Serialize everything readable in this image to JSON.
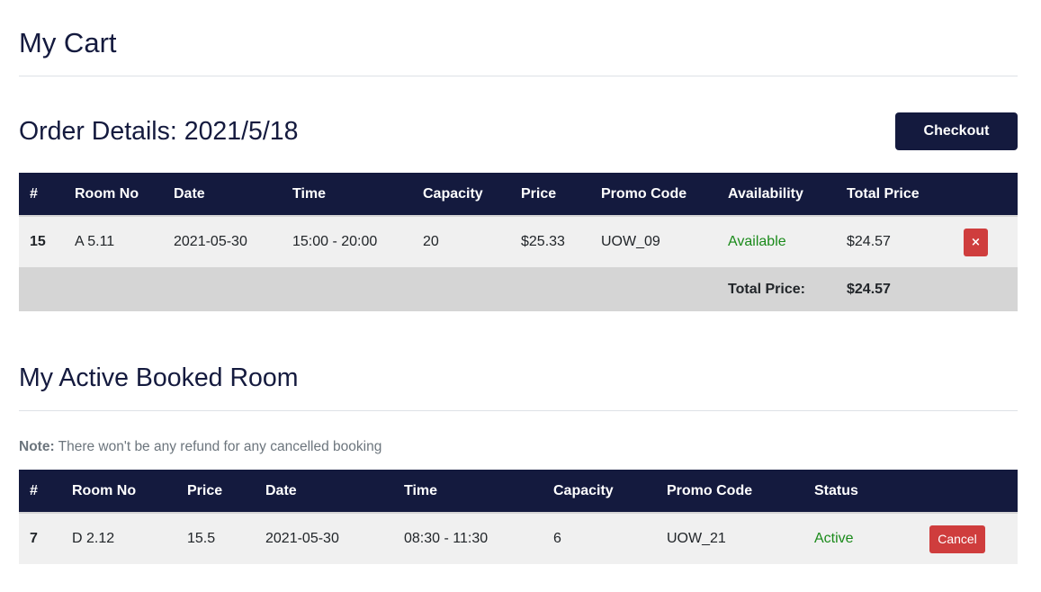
{
  "cart": {
    "title": "My Cart",
    "order_title": "Order Details: 2021/5/18",
    "checkout_label": "Checkout",
    "headers": [
      "#",
      "Room No",
      "Date",
      "Time",
      "Capacity",
      "Price",
      "Promo Code",
      "Availability",
      "Total Price"
    ],
    "items": [
      {
        "id": "15",
        "room_no": "A 5.11",
        "date": "2021-05-30",
        "time": "15:00 - 20:00",
        "capacity": "20",
        "price": "$25.33",
        "promo_code": "UOW_09",
        "availability": "Available",
        "total_price": "$24.57",
        "remove_label": "×"
      }
    ],
    "total_label": "Total Price:",
    "total_value": "$24.57"
  },
  "booked": {
    "title": "My Active Booked Room",
    "note_label": "Note:",
    "note_text": " There won't be any refund for any cancelled booking",
    "headers": [
      "#",
      "Room No",
      "Price",
      "Date",
      "Time",
      "Capacity",
      "Promo Code",
      "Status"
    ],
    "items": [
      {
        "id": "7",
        "room_no": "D 2.12",
        "price": "15.5",
        "date": "2021-05-30",
        "time": "08:30 - 11:30",
        "capacity": "6",
        "promo_code": "UOW_21",
        "status": "Active",
        "cancel_label": "Cancel"
      }
    ]
  },
  "colors": {
    "navy": "#141a3e",
    "danger": "#cf3d3d",
    "success": "#1a8a1a"
  }
}
